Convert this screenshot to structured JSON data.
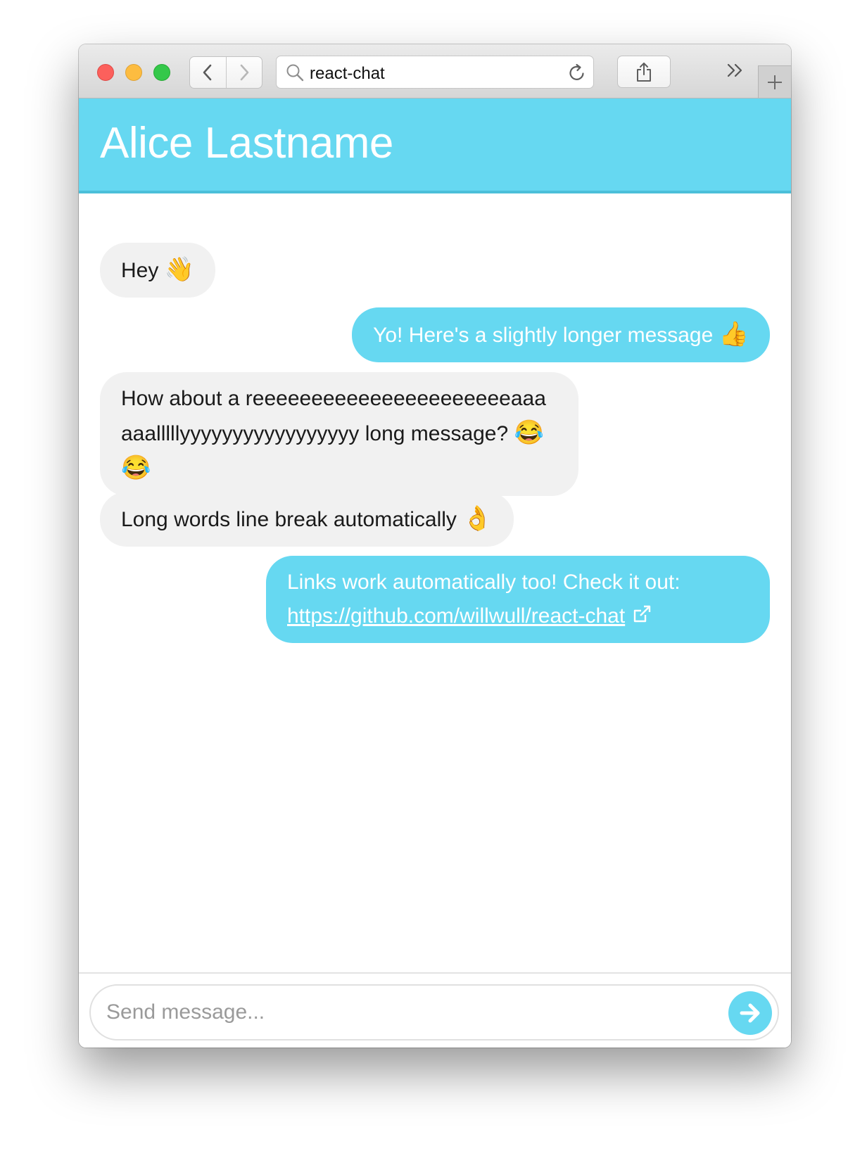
{
  "browser": {
    "url": "react-chat",
    "buttons": {
      "back": "back",
      "forward": "forward",
      "reload": "reload",
      "share": "share",
      "overflow": "more",
      "new_tab": "new-tab"
    }
  },
  "chat": {
    "title": "Alice Lastname",
    "messages": [
      {
        "from": "them",
        "text": "Hey",
        "emoji": "👋"
      },
      {
        "from": "me",
        "text": "Yo! Here's a slightly longer message",
        "emoji": "👍"
      },
      {
        "from": "them",
        "text": "How about a reeeeeeeeeeeeeeeeeeeeeeaaaaaalllllyyyyyyyyyyyyyyyyy long message?",
        "emoji": "😂😂"
      },
      {
        "from": "them",
        "text": "Long words line break automatically",
        "emoji": "👌"
      },
      {
        "from": "me",
        "text": "Links work automatically too! Check it out:",
        "link": "https://github.com/willwull/react-chat"
      }
    ]
  },
  "composer": {
    "placeholder": "Send message...",
    "send_icon": "arrow-right-icon"
  },
  "colors": {
    "accent": "#66d8f1",
    "incoming_bubble": "#f1f1f1",
    "incoming_text": "#1a1a1a",
    "outgoing_text": "#ffffff"
  }
}
